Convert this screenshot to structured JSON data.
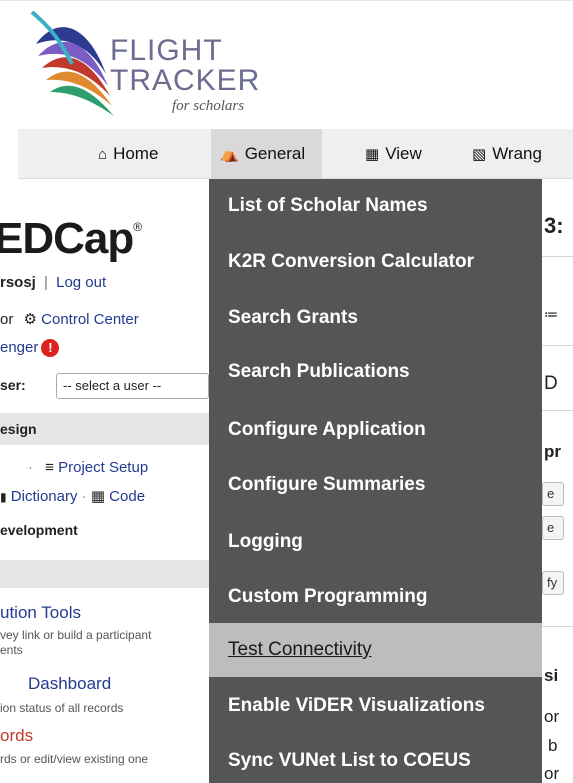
{
  "logo": {
    "line1": "FLIGHT",
    "line2": "TRACKER",
    "tagline": "for scholars",
    "colors": [
      "#2c3a8f",
      "#6a4fb0",
      "#c0392b",
      "#e08a2f",
      "#2e9e6e"
    ]
  },
  "nav": {
    "items": [
      {
        "icon": "home-icon",
        "label": "Home"
      },
      {
        "icon": "bank-icon",
        "label": "General"
      },
      {
        "icon": "table-icon",
        "label": "View"
      },
      {
        "icon": "calculator-icon",
        "label": "Wrang"
      }
    ]
  },
  "dropdown": {
    "items": [
      "List of Scholar Names",
      "K2R Conversion Calculator",
      "Search Grants",
      "Search Publications",
      "Configure Application",
      "Configure Summaries",
      "Logging",
      "Custom Programming",
      "Test Connectivity",
      "Enable ViDER Visualizations",
      "Sync VUNet List to COEUS"
    ],
    "hover_index": 8
  },
  "sidebar": {
    "logo": "EDCap",
    "logo_mark": "®",
    "user": "rsosj",
    "separator": "|",
    "logout": "Log out",
    "control_prefix": "or",
    "control_center": "Control Center",
    "messenger": "enger",
    "messenger_badge": "!",
    "user_label": "ser:",
    "user_select": "-- select a user --",
    "design_header": "esign",
    "dot": "·",
    "project_setup": "Project Setup",
    "dictionary": "Dictionary",
    "dict_dot": "·",
    "codebook": "Code",
    "dev_status": "evelopment",
    "dist_tools": "ution Tools",
    "dist_desc1": "vey link or build a participant",
    "dist_desc2": "ents",
    "dashboard": "Dashboard",
    "dashboard_desc": "ion status of all records",
    "records": "ords",
    "records_desc": "rds or edit/view existing one"
  },
  "right_strip": {
    "t1": "3:",
    "t2": "≔",
    "t3": "D",
    "t4": "pr",
    "b1": "e",
    "b2": "e",
    "b3": "fy",
    "t5": "si",
    "t6": "or",
    "t7": "b",
    "t8": "or"
  }
}
